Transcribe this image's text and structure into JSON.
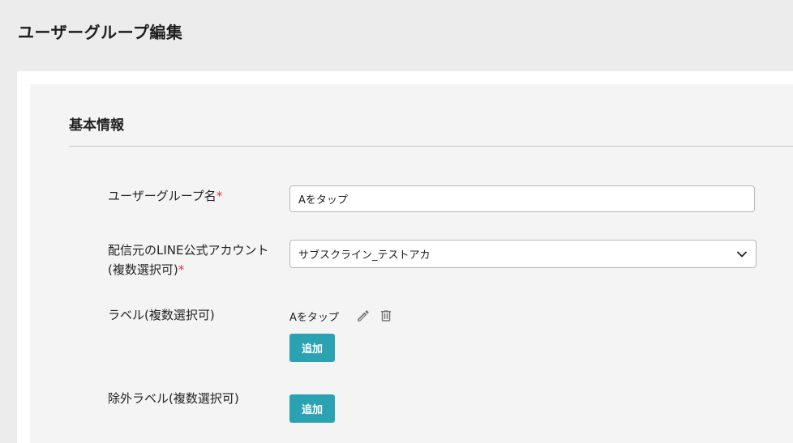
{
  "page": {
    "title": "ユーザーグループ編集"
  },
  "section": {
    "title": "基本情報"
  },
  "fields": {
    "group_name": {
      "label": "ユーザーグループ名",
      "required_mark": "*",
      "value": "Aをタップ"
    },
    "line_account": {
      "label_line1": "配信元のLINE公式アカウント",
      "label_line2": "(複数選択可)",
      "required_mark": "*",
      "selected": "サブスクライン_テストアカ"
    },
    "labels": {
      "label": "ラベル(複数選択可)",
      "items": [
        {
          "text": "Aをタップ"
        }
      ],
      "add_label": "追加"
    },
    "exclude_labels": {
      "label": "除外ラベル(複数選択可)",
      "add_label": "追加"
    }
  },
  "icons": {
    "edit": "pencil-icon",
    "delete": "trash-icon",
    "dropdown": "chevron-down-icon"
  },
  "colors": {
    "accent": "#2ba2b2",
    "required": "#d9363e",
    "background": "#ececec",
    "panel": "#f4f4f4"
  }
}
